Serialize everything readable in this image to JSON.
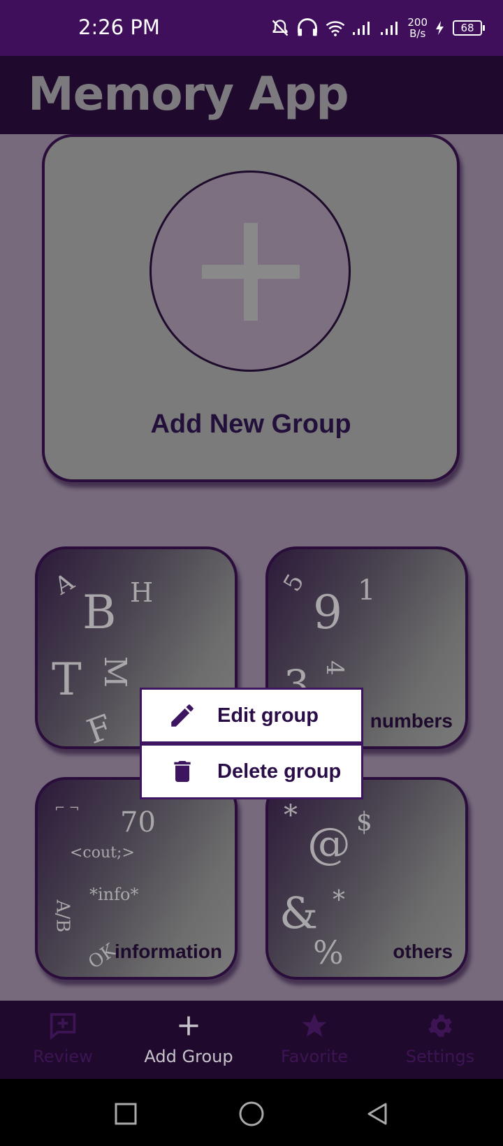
{
  "status_bar": {
    "time": "2:26 PM",
    "speed_value": "200",
    "speed_unit": "B/s",
    "battery": "68"
  },
  "app_bar": {
    "title": "Memory App"
  },
  "add_card": {
    "label": "Add New Group"
  },
  "groups": [
    {
      "label": "",
      "deco": [
        "A",
        "B",
        "H",
        "T",
        "M",
        "F"
      ]
    },
    {
      "label": "numbers",
      "deco": [
        "5",
        "9",
        "1",
        "3",
        "4"
      ]
    },
    {
      "label": "information",
      "deco": [
        "70",
        "<cout;>",
        "*info*",
        "A/B",
        "OK"
      ]
    },
    {
      "label": "others",
      "deco": [
        "*",
        "@",
        "$",
        "&",
        "*",
        "%"
      ]
    }
  ],
  "context_menu": {
    "edit_label": "Edit group",
    "delete_label": "Delete group"
  },
  "bottom_nav": {
    "items": [
      {
        "label": "Review",
        "icon": "review-icon"
      },
      {
        "label": "Add Group",
        "icon": "plus-icon"
      },
      {
        "label": "Favorite",
        "icon": "star-icon"
      },
      {
        "label": "Settings",
        "icon": "gear-icon"
      }
    ]
  },
  "colors": {
    "primary": "#3f0f5c",
    "dark": "#1f0a2e",
    "scrim": "#766a7c",
    "card": "#7b7b7b",
    "accent_text": "#2a0d47"
  }
}
